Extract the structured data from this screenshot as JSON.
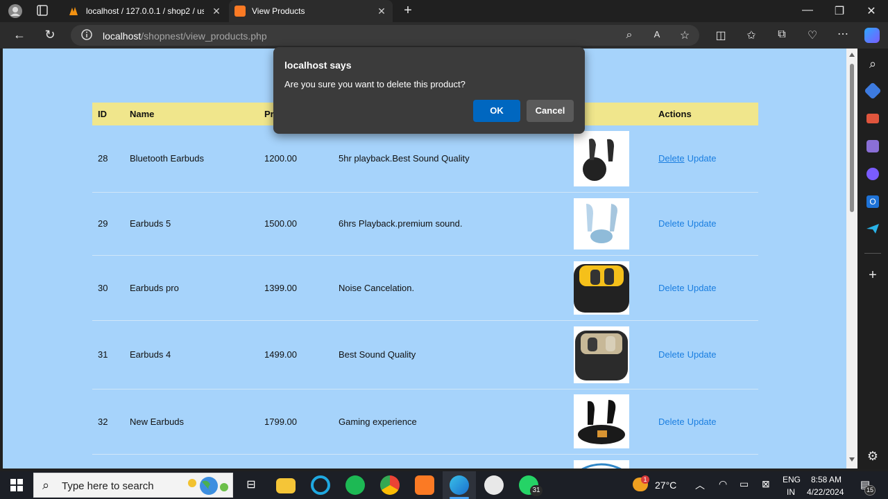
{
  "browser": {
    "tabs": [
      {
        "title": "localhost / 127.0.0.1 / shop2 / us",
        "active": false
      },
      {
        "title": "View Products",
        "active": true
      }
    ],
    "url_host": "localhost",
    "url_path": "/shopnest/view_products.php"
  },
  "table": {
    "headers": [
      "ID",
      "Name",
      "Pr",
      "",
      "",
      "Actions"
    ],
    "rows": [
      {
        "id": "28",
        "name": "Bluetooth Earbuds",
        "price": "1200.00",
        "description": "5hr playback.Best Sound Quality",
        "image": "earbuds-image-black-round"
      },
      {
        "id": "29",
        "name": "Earbuds 5",
        "price": "1500.00",
        "description": "6hrs Playback.premium sound.",
        "image": "earbuds-image-silver-blue"
      },
      {
        "id": "30",
        "name": "Earbuds pro",
        "price": "1399.00",
        "description": "Noise Cancelation.",
        "image": "earbuds-image-black-yellow-case"
      },
      {
        "id": "31",
        "name": "Earbuds 4",
        "price": "1499.00",
        "description": "Best Sound Quality",
        "image": "earbuds-image-realme-case"
      },
      {
        "id": "32",
        "name": "New Earbuds",
        "price": "1799.00",
        "description": "Gaming experience",
        "image": "earbuds-image-gaming"
      }
    ],
    "delete_label": "Delete",
    "update_label": "Update"
  },
  "dialog": {
    "title": "localhost says",
    "message": "Are you sure you want to delete this product?",
    "ok_label": "OK",
    "cancel_label": "Cancel"
  },
  "taskbar": {
    "search_placeholder": "Type here to search",
    "weather": "27°C",
    "lang_top": "ENG",
    "lang_bottom": "IN",
    "time": "8:58 AM",
    "date": "4/22/2024",
    "whatsapp_badge": "31",
    "notifications_badge": "15",
    "weather_badge": "1"
  },
  "colors": {
    "page_background": "#a6d3fb",
    "header_background": "#f0e68c",
    "link": "#1a7ee0",
    "ok_button": "#0067c0"
  }
}
